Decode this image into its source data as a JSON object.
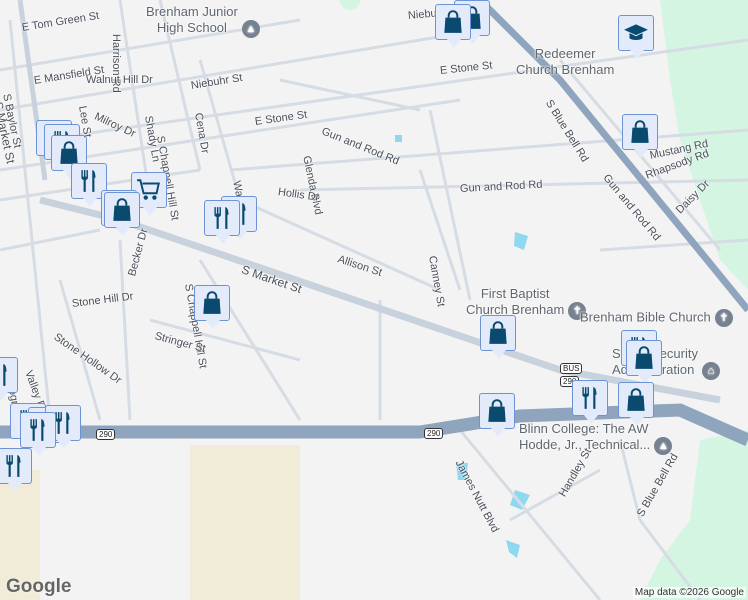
{
  "streets": [
    "E Tom Green St",
    "Harrison Rd",
    "S Market St",
    "E Mansfield St",
    "Walnut Hill Dr",
    "S Baylor St",
    "Niebuhr St",
    "Milroy Dr",
    "Lee St",
    "Shady Ln",
    "S Chappell Hill St",
    "Cena Dr",
    "E Stone St",
    "Gun and Rod Rd",
    "Glenda Blvd",
    "Walnut St",
    "Hollis Dr",
    "Allison St",
    "S Market St",
    "Becker Dr",
    "Stone Hill Dr",
    "S Chappell Hill St",
    "Stringer St",
    "Stone Hollow Dr",
    "Valley Dr",
    "Progress",
    "Canney St",
    "Gun and Rod Rd",
    "Rhapsody Rd",
    "Daisy Dr",
    "Mustang Rd",
    "S Blue Bell Rd",
    "Gun and Rod Rd",
    "E Stone St",
    "Niebuhr St",
    "James Nutt Blvd",
    "Handley St",
    "S Blue Bell Rd",
    "St"
  ],
  "pois": {
    "junior_high": "Brenham Junior\nHigh School",
    "redeemer": "Redeemer\nChurch Brenham",
    "first_baptist": "First Baptist\nChurch Brenham",
    "bible_church": "Brenham Bible Church",
    "ssa": "Social Security\nAdministration",
    "blinn": "Blinn College: The AW\nHodde, Jr., Technical..."
  },
  "shields": {
    "us290_a": "290",
    "us290_b": "290",
    "bus": "BUS",
    "bus290": "290"
  },
  "attribution": "Map data ©2026 Google",
  "logo": "Google",
  "colors": {
    "pin_fill": "#e3ebfb",
    "pin_border": "#6b93d6",
    "icon": "#0b4a6f",
    "highway": "#8fa4bd",
    "road": "#d5dce4",
    "park": "#d4f5e2",
    "water": "#8ed8f0"
  }
}
